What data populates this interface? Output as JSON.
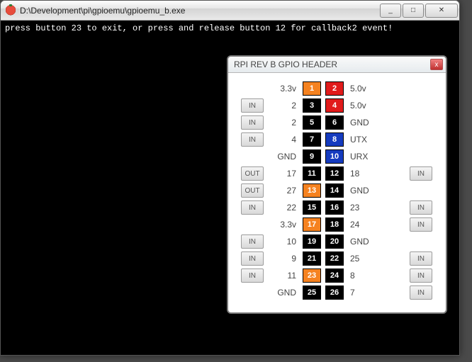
{
  "window": {
    "title": "D:\\Development\\pi\\gpioemu\\gpioemu_b.exe",
    "min": "_",
    "max": "□",
    "close": "✕"
  },
  "console": {
    "line": "press button 23 to exit, or press and release button 12 for callback2 event!"
  },
  "panel": {
    "title": "RPI REV B GPIO HEADER",
    "close": "x",
    "rows": [
      {
        "lMode": "",
        "lLabel": "3.3v",
        "p1": "1",
        "p1c": "bg-orange",
        "p2": "2",
        "p2c": "bg-red",
        "rLabel": "5.0v",
        "rMode": ""
      },
      {
        "lMode": "IN",
        "lLabel": "2",
        "p1": "3",
        "p1c": "bg-black",
        "p2": "4",
        "p2c": "bg-red",
        "rLabel": "5.0v",
        "rMode": ""
      },
      {
        "lMode": "IN",
        "lLabel": "2",
        "p1": "5",
        "p1c": "bg-black",
        "p2": "6",
        "p2c": "bg-black",
        "rLabel": "GND",
        "rMode": ""
      },
      {
        "lMode": "IN",
        "lLabel": "4",
        "p1": "7",
        "p1c": "bg-black",
        "p2": "8",
        "p2c": "bg-blue",
        "rLabel": "UTX",
        "rMode": ""
      },
      {
        "lMode": "",
        "lLabel": "GND",
        "p1": "9",
        "p1c": "bg-black",
        "p2": "10",
        "p2c": "bg-blue",
        "rLabel": "URX",
        "rMode": ""
      },
      {
        "lMode": "OUT",
        "lLabel": "17",
        "p1": "11",
        "p1c": "bg-black",
        "p2": "12",
        "p2c": "bg-black",
        "rLabel": "18",
        "rMode": "IN"
      },
      {
        "lMode": "OUT",
        "lLabel": "27",
        "p1": "13",
        "p1c": "bg-orange",
        "p2": "14",
        "p2c": "bg-black",
        "rLabel": "GND",
        "rMode": ""
      },
      {
        "lMode": "IN",
        "lLabel": "22",
        "p1": "15",
        "p1c": "bg-black",
        "p2": "16",
        "p2c": "bg-black",
        "rLabel": "23",
        "rMode": "IN"
      },
      {
        "lMode": "",
        "lLabel": "3.3v",
        "p1": "17",
        "p1c": "bg-orange",
        "p2": "18",
        "p2c": "bg-black",
        "rLabel": "24",
        "rMode": "IN"
      },
      {
        "lMode": "IN",
        "lLabel": "10",
        "p1": "19",
        "p1c": "bg-black",
        "p2": "20",
        "p2c": "bg-black",
        "rLabel": "GND",
        "rMode": ""
      },
      {
        "lMode": "IN",
        "lLabel": "9",
        "p1": "21",
        "p1c": "bg-black",
        "p2": "22",
        "p2c": "bg-black",
        "rLabel": "25",
        "rMode": "IN"
      },
      {
        "lMode": "IN",
        "lLabel": "11",
        "p1": "23",
        "p1c": "bg-orange",
        "p2": "24",
        "p2c": "bg-black",
        "rLabel": "8",
        "rMode": "IN"
      },
      {
        "lMode": "",
        "lLabel": "GND",
        "p1": "25",
        "p1c": "bg-black",
        "p2": "26",
        "p2c": "bg-black",
        "rLabel": "7",
        "rMode": "IN"
      }
    ]
  }
}
